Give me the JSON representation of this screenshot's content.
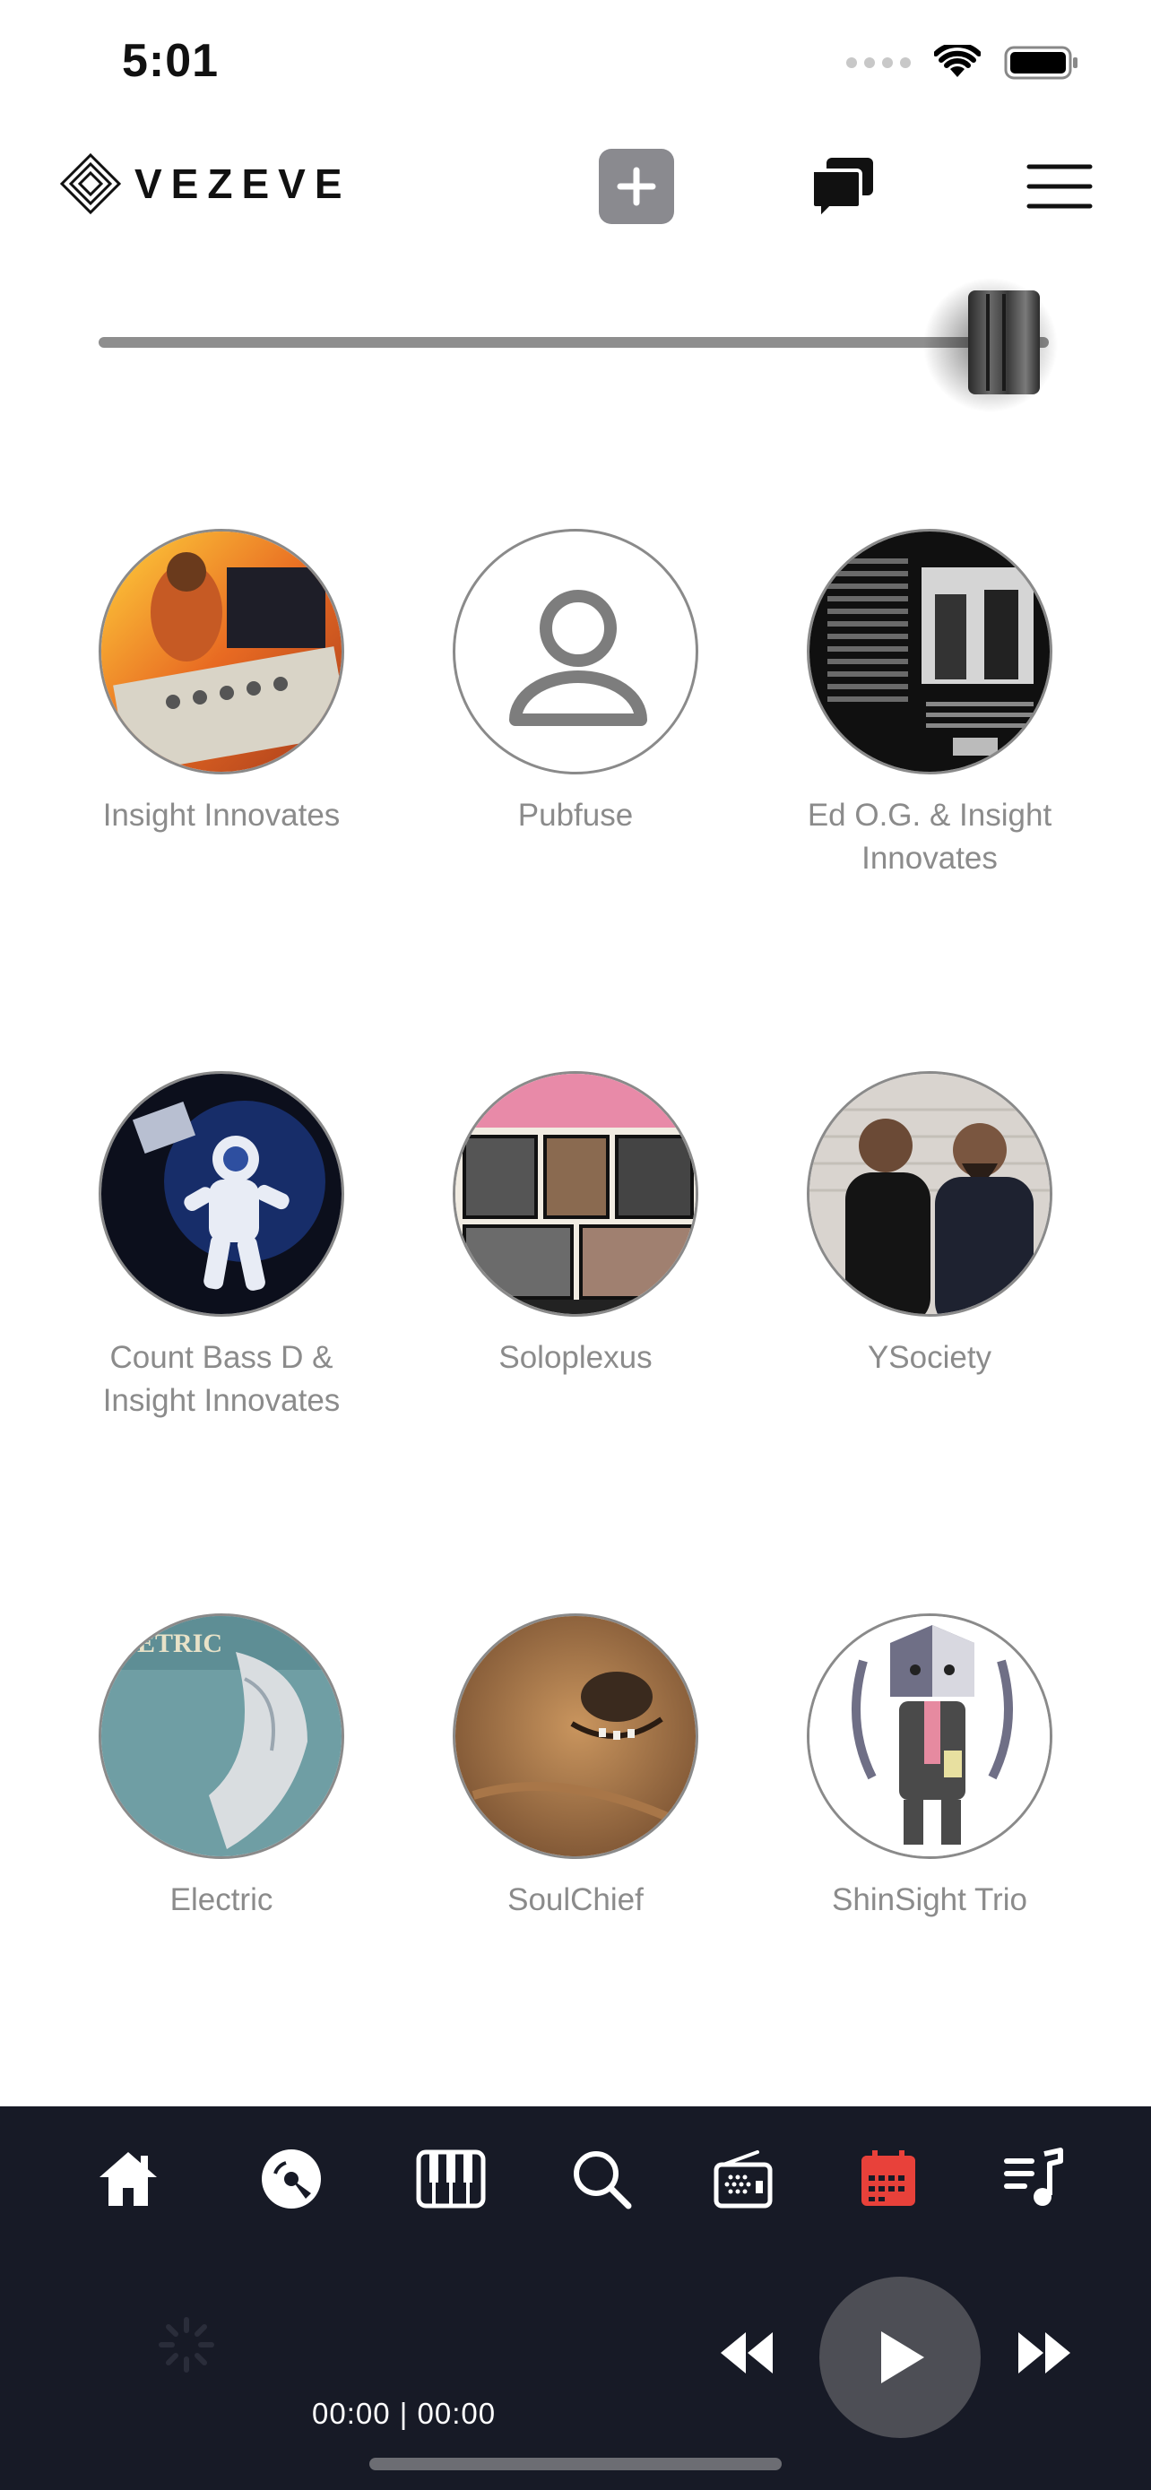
{
  "status": {
    "time": "5:01"
  },
  "header": {
    "logo_text": "VEZEVE"
  },
  "artists": [
    {
      "name": "Insight Innovates",
      "avatar": "photo-drummer"
    },
    {
      "name": "Pubfuse",
      "avatar": "person-placeholder-icon"
    },
    {
      "name": "Ed O.G. & Insight Innovates",
      "avatar": "photo-album-back"
    },
    {
      "name": "Count Bass D & Insight Innovates",
      "avatar": "photo-astronaut"
    },
    {
      "name": "Soloplexus",
      "avatar": "photo-comic-cover"
    },
    {
      "name": "YSociety",
      "avatar": "photo-two-men"
    },
    {
      "name": "Electric",
      "avatar": "photo-electric-company"
    },
    {
      "name": "SoulChief",
      "avatar": "photo-dog"
    },
    {
      "name": "ShinSight Trio",
      "avatar": "illustration-character"
    }
  ],
  "tabs": [
    {
      "icon": "home-icon"
    },
    {
      "icon": "disc-icon"
    },
    {
      "icon": "piano-icon"
    },
    {
      "icon": "search-icon"
    },
    {
      "icon": "radio-icon"
    },
    {
      "icon": "calendar-icon",
      "active": true
    },
    {
      "icon": "playlist-icon"
    }
  ],
  "player": {
    "time": "00:00 | 00:00"
  },
  "colors": {
    "accent": "#e8413a",
    "tabbar_bg": "#171a26",
    "label": "#8b8b8b"
  }
}
